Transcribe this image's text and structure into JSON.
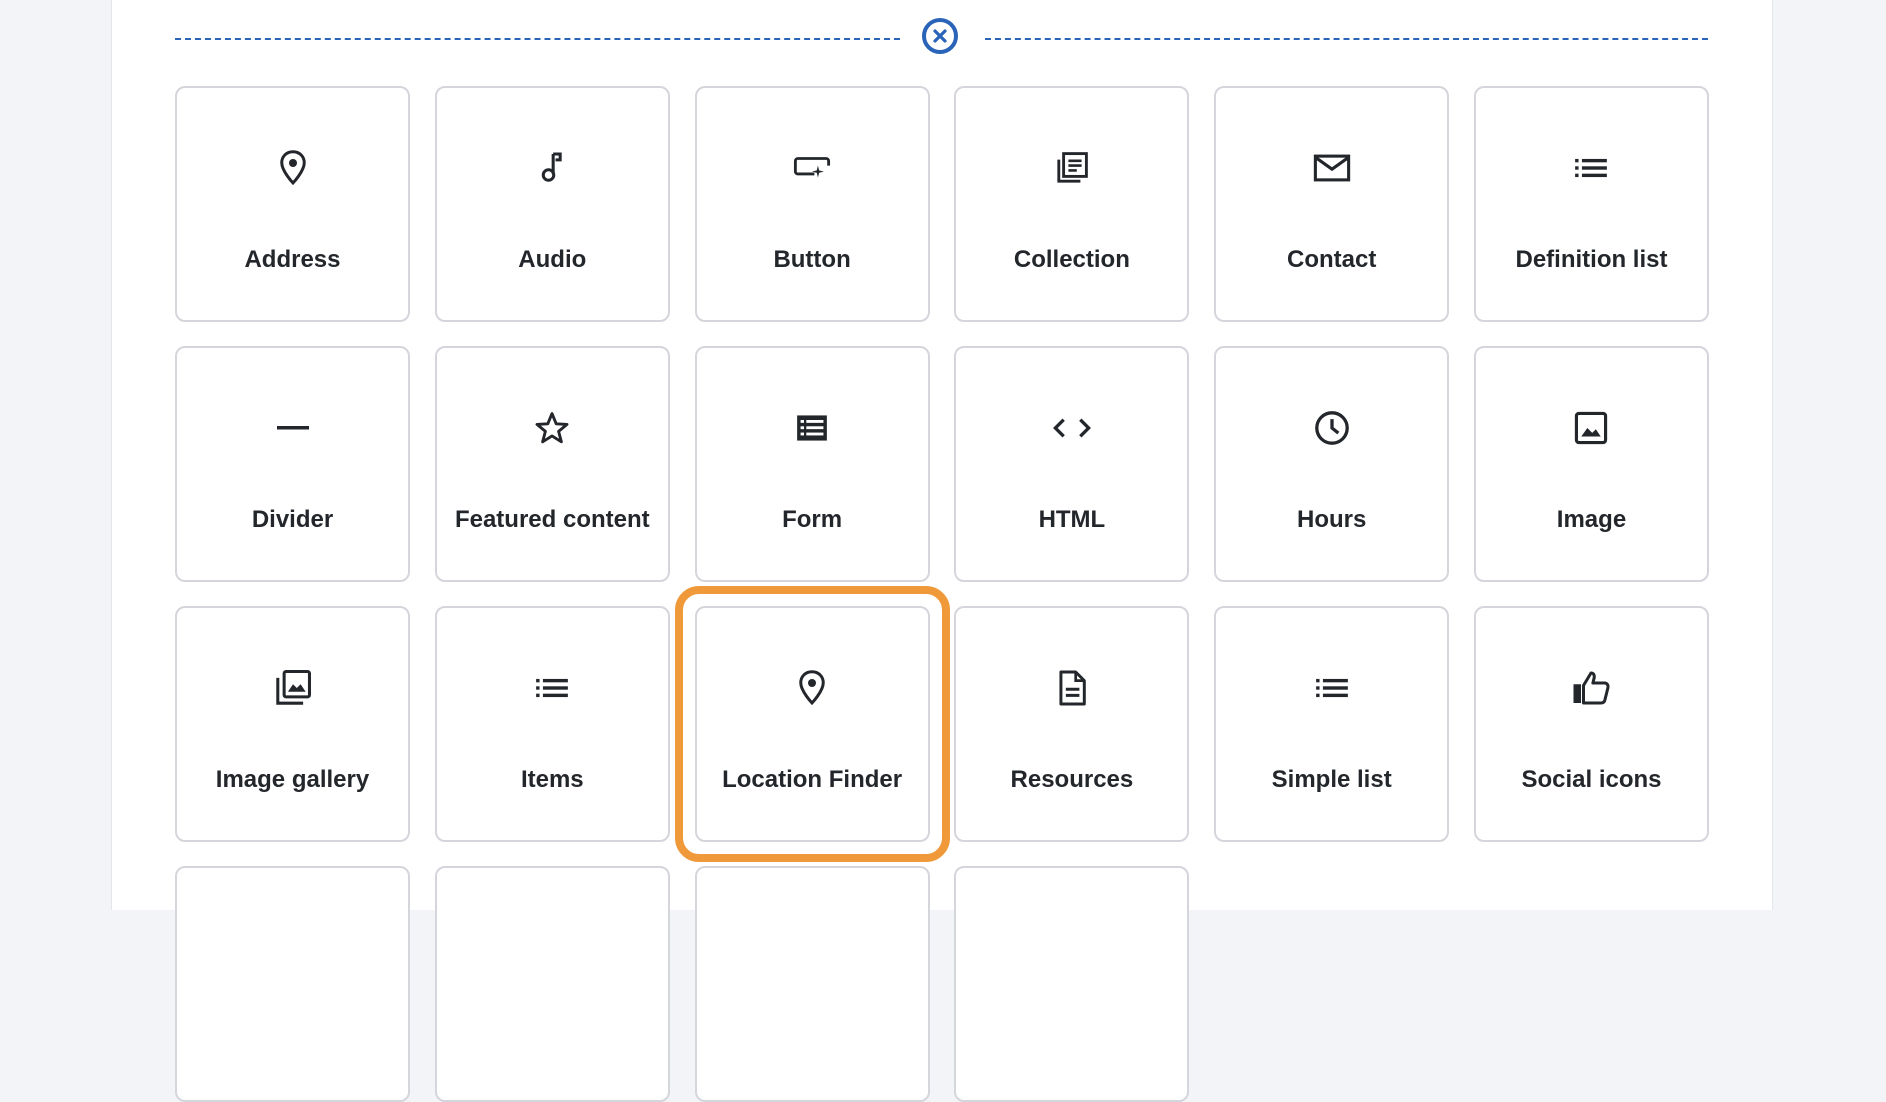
{
  "colors": {
    "accent": "#2a64b8",
    "highlight": "#f0993a",
    "tile_border": "#d4d6db",
    "text": "#23262b",
    "background": "#f3f4f8"
  },
  "close_button": {
    "icon": "close-icon"
  },
  "tiles": [
    {
      "label": "Address",
      "icon": "map-pin-icon"
    },
    {
      "label": "Audio",
      "icon": "music-note-icon"
    },
    {
      "label": "Button",
      "icon": "button-cursor-icon"
    },
    {
      "label": "Collection",
      "icon": "collection-icon"
    },
    {
      "label": "Contact",
      "icon": "envelope-icon"
    },
    {
      "label": "Definition list",
      "icon": "list-icon"
    },
    {
      "label": "Divider",
      "icon": "horizontal-rule-icon"
    },
    {
      "label": "Featured content",
      "icon": "star-icon"
    },
    {
      "label": "Form",
      "icon": "form-icon"
    },
    {
      "label": "HTML",
      "icon": "code-icon"
    },
    {
      "label": "Hours",
      "icon": "clock-icon"
    },
    {
      "label": "Image",
      "icon": "image-icon"
    },
    {
      "label": "Image gallery",
      "icon": "image-gallery-icon"
    },
    {
      "label": "Items",
      "icon": "list-icon"
    },
    {
      "label": "Location Finder",
      "icon": "map-pin-icon",
      "highlighted": true
    },
    {
      "label": "Resources",
      "icon": "document-icon"
    },
    {
      "label": "Simple list",
      "icon": "list-icon"
    },
    {
      "label": "Social icons",
      "icon": "thumbs-up-icon"
    }
  ]
}
